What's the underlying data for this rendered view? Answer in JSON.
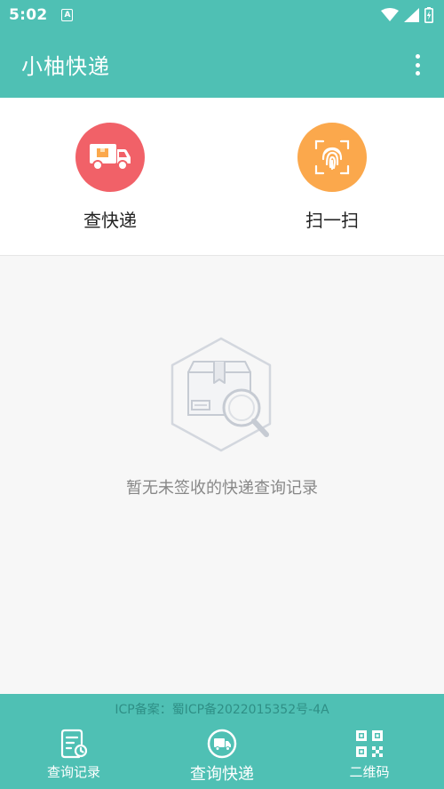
{
  "status_bar": {
    "time": "5:02",
    "notification_icon": "A",
    "icons": [
      "wifi-icon",
      "signal-icon",
      "battery-charging-icon"
    ]
  },
  "app_bar": {
    "title": "小柚快递",
    "menu_icon": "more-vert-icon"
  },
  "actions": [
    {
      "label": "查快递",
      "icon": "delivery-truck-icon",
      "color": "#f16168"
    },
    {
      "label": "扫一扫",
      "icon": "fingerprint-scan-icon",
      "color": "#fba84c"
    }
  ],
  "empty_state": {
    "icon": "package-search-icon",
    "message": "暂无未签收的快递查询记录"
  },
  "footer": {
    "icp": "ICP备案：蜀ICP备2022015352号-4A"
  },
  "bottom_nav": [
    {
      "label": "查询记录",
      "icon": "history-document-icon",
      "active": false
    },
    {
      "label": "查询快递",
      "icon": "truck-circle-icon",
      "active": true
    },
    {
      "label": "二维码",
      "icon": "qr-code-icon",
      "active": false
    }
  ],
  "colors": {
    "primary": "#4fc0b4",
    "red_accent": "#f16168",
    "orange_accent": "#fba84c",
    "background": "#f7f7f7"
  }
}
